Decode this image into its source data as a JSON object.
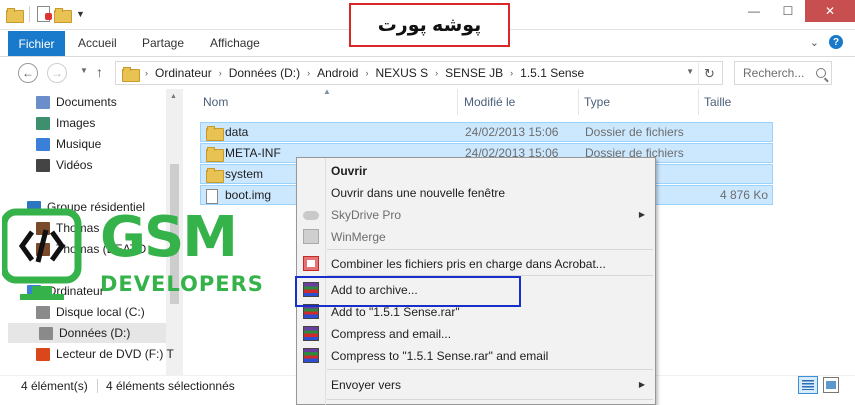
{
  "title_banner": "پوشه پورت",
  "window_controls": {
    "minimize": "—",
    "maximize": "☐",
    "close": "✕"
  },
  "ribbon": {
    "file_tab": "Fichier",
    "tabs": [
      "Accueil",
      "Partage",
      "Affichage"
    ],
    "expand": "⌄",
    "help": "?"
  },
  "address": {
    "breadcrumbs": [
      "Ordinateur",
      "Données (D:)",
      "Android",
      "NEXUS S",
      "SENSE JB",
      "1.5.1 Sense"
    ],
    "search_placeholder": "Recherch..."
  },
  "nav_pane": {
    "items": [
      {
        "label": "Documents",
        "icon": "documents-icon",
        "color": "#6a8ec9"
      },
      {
        "label": "Images",
        "icon": "images-icon",
        "color": "#3e8f6d"
      },
      {
        "label": "Musique",
        "icon": "music-icon",
        "color": "#3a7fd8"
      },
      {
        "label": "Vidéos",
        "icon": "videos-icon",
        "color": "#444444"
      },
      {
        "label": "Groupe résidentiel",
        "icon": "homegroup-icon",
        "color": "#2d77c2"
      },
      {
        "label": "Thomas",
        "icon": "user-icon",
        "color": "#7a4a2a"
      },
      {
        "label": "Thomas (BEATO",
        "icon": "user-icon",
        "color": "#7a4a2a"
      },
      {
        "label": "Ordinateur",
        "icon": "computer-icon",
        "color": "#3a7fd8"
      },
      {
        "label": "Disque local (C:)",
        "icon": "drive-icon",
        "color": "#8a8a8a"
      },
      {
        "label": "Données (D:)",
        "icon": "drive-icon",
        "color": "#8a8a8a"
      },
      {
        "label": "Lecteur de DVD (F:) T",
        "icon": "dvd-icon",
        "color": "#d9471a"
      }
    ]
  },
  "columns": {
    "name": "Nom",
    "modified": "Modifié le",
    "type": "Type",
    "size": "Taille"
  },
  "files": [
    {
      "name": "data",
      "modified": "24/02/2013 15:06",
      "type": "Dossier de fichiers",
      "size": "",
      "kind": "folder"
    },
    {
      "name": "META-INF",
      "modified": "24/02/2013 15:06",
      "type": "Dossier de fichiers",
      "size": "",
      "kind": "folder"
    },
    {
      "name": "system",
      "modified": "",
      "type": "",
      "size": "",
      "kind": "folder"
    },
    {
      "name": "boot.img",
      "modified": "",
      "type": "",
      "size": "4 876 Ko",
      "kind": "file"
    }
  ],
  "watermark": {
    "big": "GSM",
    "small": "DEVELOPERS"
  },
  "context_menu": {
    "items": [
      {
        "label": "Ouvrir",
        "style": "bold",
        "icon": ""
      },
      {
        "label": "Ouvrir dans une nouvelle fenêtre",
        "style": "",
        "icon": ""
      },
      {
        "label": "SkyDrive Pro",
        "style": "disabled",
        "icon": "skydrive-icon",
        "submenu": true
      },
      {
        "label": "WinMerge",
        "style": "disabled",
        "icon": "winmerge-icon"
      },
      {
        "label": "Combiner les fichiers pris en charge dans Acrobat...",
        "style": "",
        "icon": "acrobat-icon"
      },
      {
        "label": "Add to archive...",
        "style": "",
        "icon": "winrar-icon"
      },
      {
        "label": "Add to \"1.5.1 Sense.rar\"",
        "style": "",
        "icon": "winrar-icon"
      },
      {
        "label": "Compress and email...",
        "style": "",
        "icon": "winrar-icon"
      },
      {
        "label": "Compress to \"1.5.1 Sense.rar\" and email",
        "style": "",
        "icon": "winrar-icon"
      },
      {
        "label": "Envoyer vers",
        "style": "",
        "icon": "",
        "submenu": true
      }
    ]
  },
  "status": {
    "count": "4 élément(s)",
    "selection": "4 éléments sélectionnés"
  }
}
